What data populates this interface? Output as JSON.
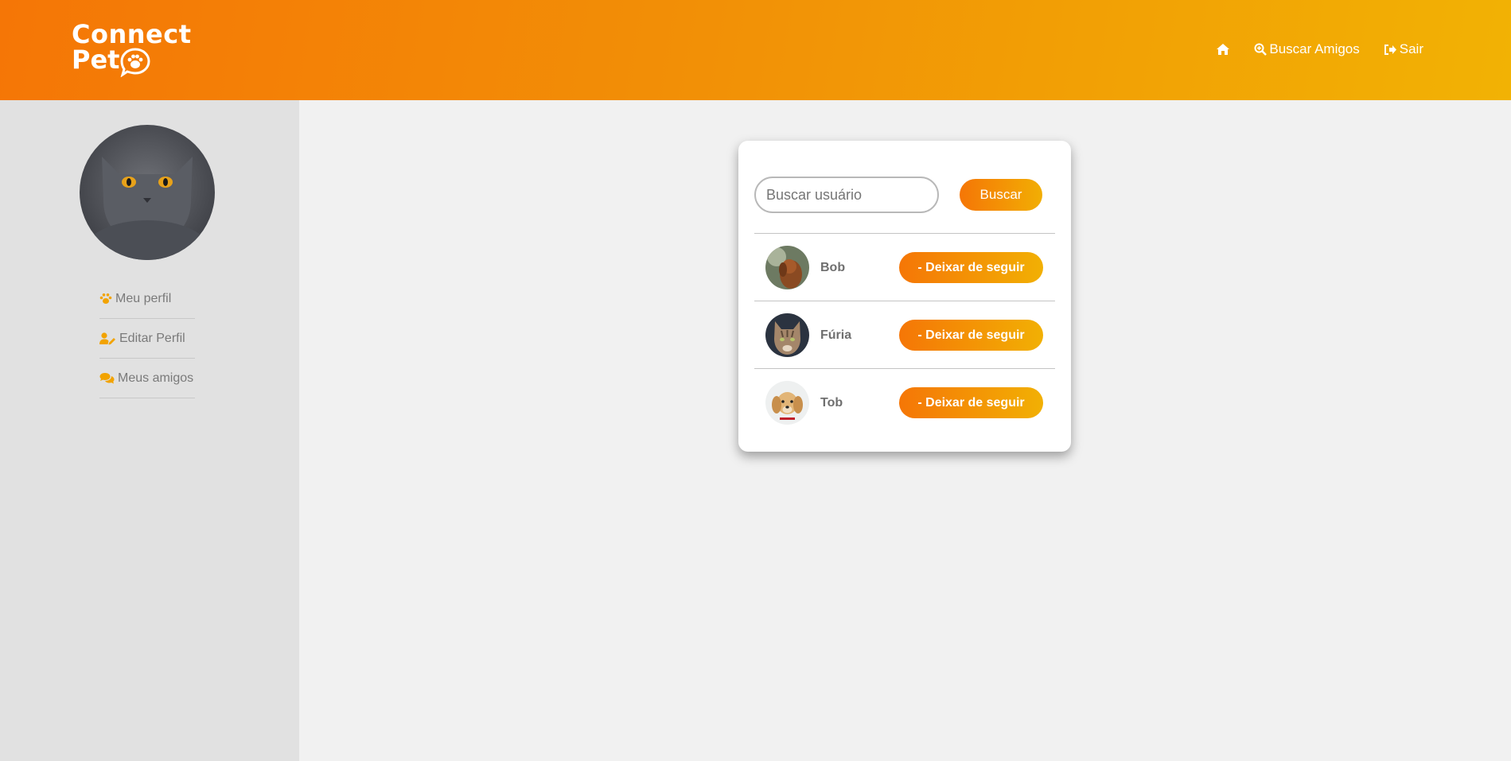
{
  "brand": {
    "line1": "Connect",
    "line2": "Pet"
  },
  "nav": {
    "home_icon": "home-icon",
    "search_friends": {
      "icon": "search-plus-icon",
      "label": "Buscar Amigos"
    },
    "logout": {
      "icon": "sign-out-icon",
      "label": "Sair"
    }
  },
  "sidebar": {
    "avatar": "gray-cat-photo",
    "items": [
      {
        "icon": "paw-icon",
        "label": "Meu perfil"
      },
      {
        "icon": "user-edit-icon",
        "label": "Editar Perfil"
      },
      {
        "icon": "comments-icon",
        "label": "Meus amigos"
      }
    ]
  },
  "search": {
    "placeholder": "Buscar usuário",
    "button_label": "Buscar"
  },
  "friends": [
    {
      "name": "Bob",
      "photo": "brown-dog-photo",
      "action_label": "- Deixar de seguir"
    },
    {
      "name": "Fúria",
      "photo": "tabby-cat-photo",
      "action_label": "- Deixar de seguir"
    },
    {
      "name": "Tob",
      "photo": "golden-puppy-photo",
      "action_label": "- Deixar de seguir"
    }
  ],
  "colors": {
    "accent_start": "#f57606",
    "accent_end": "#f2b204",
    "sidebar_bg": "#e1e1e1",
    "page_bg": "#f1f1f1"
  }
}
